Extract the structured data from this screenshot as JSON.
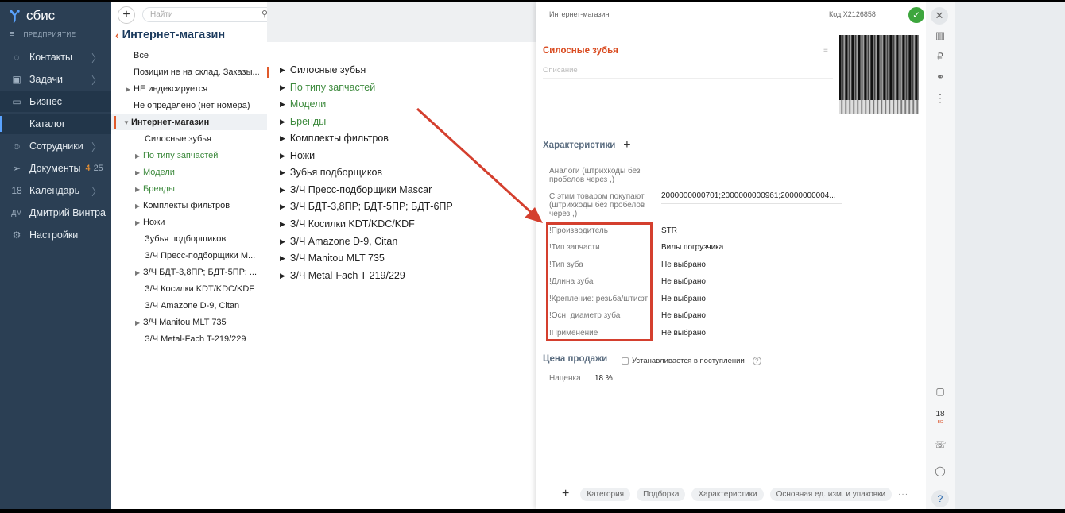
{
  "app": {
    "logo": "сбис",
    "enterprise": "ПРЕДПРИЯТИЕ"
  },
  "nav": [
    {
      "label": "Контакты",
      "icon": "chat-icon"
    },
    {
      "label": "Задачи",
      "icon": "tasks-icon"
    },
    {
      "label": "Бизнес",
      "icon": "briefcase-icon"
    },
    {
      "label": "Каталог",
      "icon": ""
    },
    {
      "label": "Сотрудники",
      "icon": "people-icon"
    },
    {
      "label": "Документы",
      "icon": "send-icon",
      "badge1": "4",
      "badge2": "25"
    },
    {
      "label": "Календарь",
      "icon": "calendar-icon",
      "iconText": "18"
    },
    {
      "label": "Дмитрий Винтра",
      "icon": "avatar",
      "iconText": "ДМ"
    },
    {
      "label": "Настройки",
      "icon": "gear-icon"
    }
  ],
  "search": {
    "placeholder": "Найти"
  },
  "page": {
    "title": "Интернет-магазин"
  },
  "tree": [
    "Все",
    "Позиции не на склад. Заказы...",
    "НЕ индексируется",
    "Не определено (нет номера)",
    "Интернет-магазин",
    "Силосные зубья",
    "По типу запчастей",
    "Модели",
    "Бренды",
    "Комплекты фильтров",
    "Ножи",
    "Зубья подборщиков",
    "З/Ч Пресс-подборщики М...",
    "З/Ч БДТ-3,8ПР; БДТ-5ПР; ...",
    "З/Ч Косилки KDT/KDC/KDF",
    "З/Ч Amazone D-9, Citan",
    "З/Ч Manitou MLT 735",
    "З/Ч Metal-Fach T-219/229"
  ],
  "catalog": [
    "Силосные зубья",
    "По типу запчастей",
    "Модели",
    "Бренды",
    "Комплекты фильтров",
    "Ножи",
    "Зубья подборщиков",
    "З/Ч Пресс-подборщики Mascar",
    "З/Ч БДТ-3,8ПР; БДТ-5ПР; БДТ-6ПР",
    "З/Ч Косилки KDT/KDC/KDF",
    "З/Ч Amazone D-9, Citan",
    "З/Ч Manitou MLT 735",
    "З/Ч Metal-Fach T-219/229"
  ],
  "card": {
    "breadcrumb": "Интернет-магазин",
    "code": "Код X2126858",
    "name": "Силосные зубья",
    "description_placeholder": "Описание",
    "characteristics_title": "Характеристики",
    "props": [
      {
        "label": "Аналоги (штрихкоды без пробелов через ,)",
        "value": ""
      },
      {
        "label": "С этим товаром покупают (штрихкоды без пробелов через ,)",
        "value": "2000000000701;2000000000961;20000000004..."
      },
      {
        "label": "!Производитель",
        "value": "STR"
      },
      {
        "label": "!Тип запчасти",
        "value": "Вилы погрузчика"
      },
      {
        "label": "!Тип зуба",
        "value": "Не выбрано"
      },
      {
        "label": "!Длина зуба",
        "value": "Не выбрано"
      },
      {
        "label": "!Крепление: резьба/штифт",
        "value": "Не выбрано"
      },
      {
        "label": "!Осн. диаметр зуба",
        "value": "Не выбрано"
      },
      {
        "label": "!Применение",
        "value": "Не выбрано"
      }
    ],
    "price_title": "Цена продажи",
    "price_checkbox": "Устанавливается в поступлении",
    "markup_label": "Наценка",
    "markup_value": "18 %",
    "bottom_tabs": [
      "Категория",
      "Подборка",
      "Характеристики",
      "Основная ед. изм. и упаковки"
    ],
    "date_day": "18",
    "date_sub": "ВС"
  },
  "colors": {
    "sidebar": "#2b3f54",
    "accent": "#e05a2b",
    "highlight": "#d43f2e",
    "ok": "#3da63d"
  }
}
